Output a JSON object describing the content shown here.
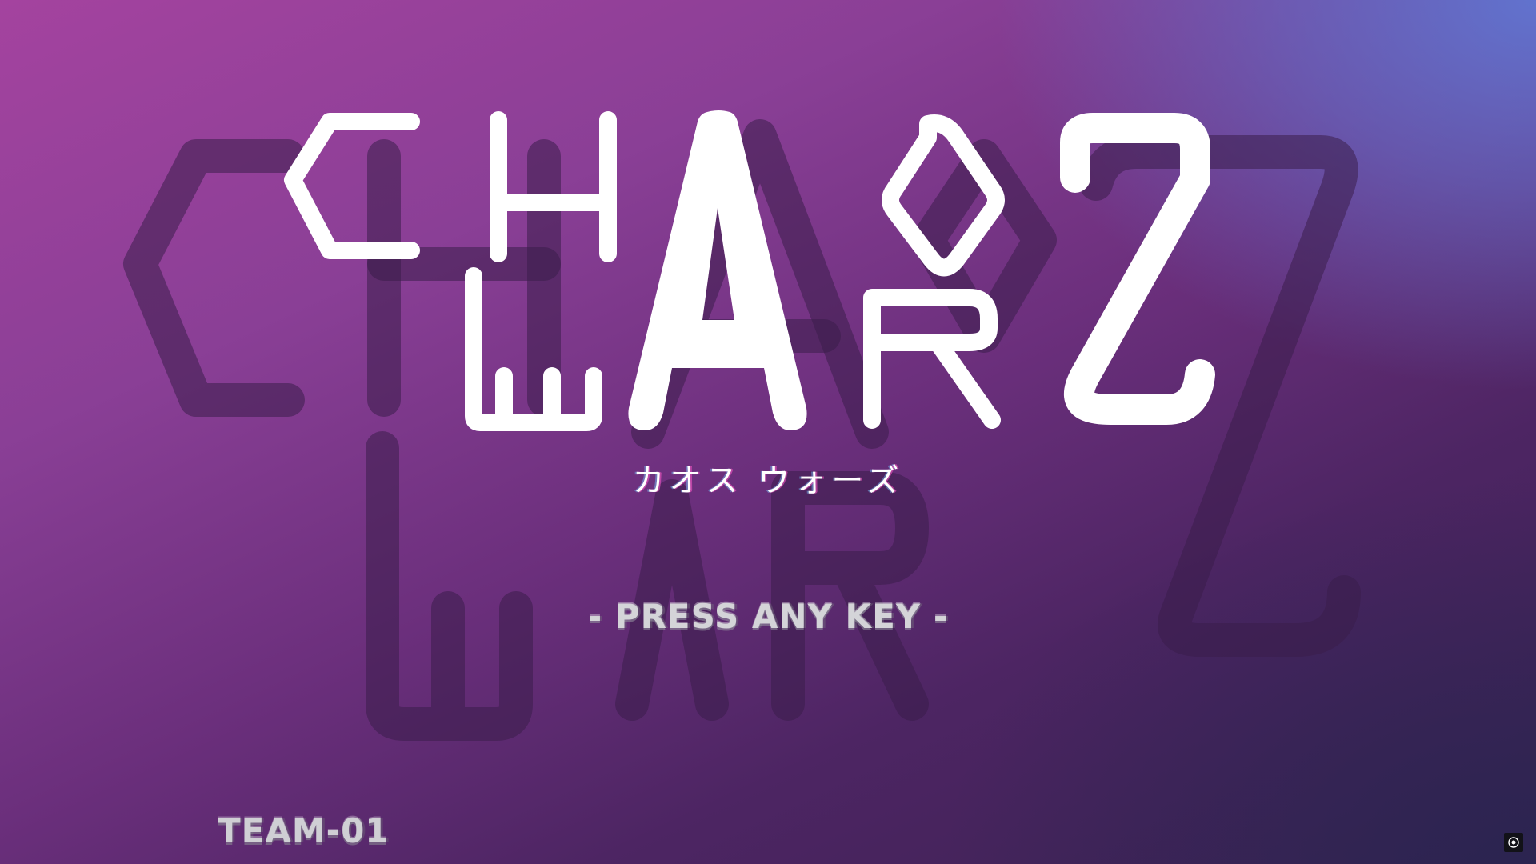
{
  "game": {
    "title_line1": [
      "C",
      "H",
      "A",
      "O"
    ],
    "title_line2": [
      "W",
      "A",
      "R",
      "Z"
    ],
    "subtitle": "カオス ウォーズ",
    "prompt": "- PRESS ANY KEY -",
    "team": "TEAM-01"
  },
  "colors": {
    "background_top_left": "#a4439f",
    "background_top_right": "#6076d2",
    "background_bottom": "#3b2252",
    "logo": "#ffffff",
    "ghost_logo": "#3a1d4a",
    "prompt_text": "#d4d4d8"
  },
  "icons": {
    "corner_button": "record-icon"
  }
}
